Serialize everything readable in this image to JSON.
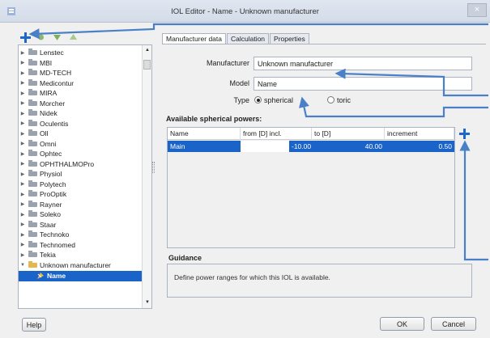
{
  "window": {
    "title": "IOL Editor - Name - Unknown manufacturer",
    "close_label": "×"
  },
  "tree": {
    "items": [
      "Lenstec",
      "MBI",
      "MD-TECH",
      "Medicontur",
      "MIRA",
      "Morcher",
      "Nidek",
      "Oculentis",
      "Oll",
      "Omni",
      "Ophtec",
      "OPHTHALMOPro",
      "Physiol",
      "Polytech",
      "ProOptik",
      "Rayner",
      "Soleko",
      "Staar",
      "Technoko",
      "Technomed",
      "Tekia",
      "Unknown manufacturer"
    ],
    "expanded_index": 21,
    "selected_child": "Name"
  },
  "tabs": [
    "Manufacturer data",
    "Calculation",
    "Properties"
  ],
  "active_tab": 0,
  "form": {
    "manufacturer_label": "Manufacturer",
    "manufacturer_value": "Unknown manufacturer",
    "model_label": "Model",
    "model_value": "Name",
    "type_label": "Type",
    "type_options": [
      "spherical",
      "toric"
    ],
    "type_selected": "spherical"
  },
  "powers": {
    "title": "Available spherical powers:",
    "columns": [
      "Name",
      "from [D] incl.",
      "to [D]",
      "increment"
    ],
    "rows": [
      {
        "name": "Main",
        "from": "-10.00",
        "to": "40.00",
        "increment": "0.50"
      }
    ]
  },
  "guidance": {
    "title": "Guidance",
    "text": "Define power ranges for which this IOL is available."
  },
  "buttons": {
    "help": "Help",
    "ok": "OK",
    "cancel": "Cancel"
  },
  "colors": {
    "accent": "#1a63c9",
    "annotation_arrow": "#4a80c8",
    "add_icon": "#1f66c9"
  },
  "icons": {
    "add": "plus-icon",
    "folder": "folder-icon",
    "leaf": "lens-icon"
  }
}
